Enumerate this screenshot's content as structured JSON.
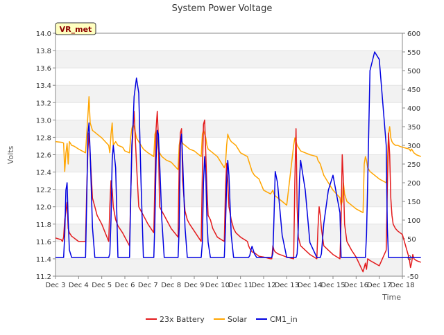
{
  "chart_data": {
    "type": "line",
    "title": "System Power Voltage",
    "xlabel": "Time",
    "ylabel": "Volts",
    "site_label": "VR_met",
    "x_ticks": [
      "Dec 3",
      "Dec 4",
      "Dec 5",
      "Dec 6",
      "Dec 7",
      "Dec 8",
      "Dec 9",
      "Dec 10",
      "Dec 11",
      "Dec 12",
      "Dec 13",
      "Dec 14",
      "Dec 15",
      "Dec 16",
      "Dec 17",
      "Dec 18"
    ],
    "x_range": [
      3,
      18
    ],
    "y_left": {
      "range": [
        11.2,
        14.0
      ],
      "ticks": [
        "11.2",
        "11.4",
        "11.6",
        "11.8",
        "12.0",
        "12.2",
        "12.4",
        "12.6",
        "12.8",
        "13.0",
        "13.2",
        "13.4",
        "13.6",
        "13.8",
        "14.0"
      ]
    },
    "y_right": {
      "range": [
        -50,
        600
      ],
      "ticks": [
        "-50",
        "0",
        "50",
        "100",
        "150",
        "200",
        "250",
        "300",
        "350",
        "400",
        "450",
        "500",
        "550",
        "600"
      ]
    },
    "grid": true,
    "legend_position": "bottom",
    "series": [
      {
        "name": "23x Battery",
        "axis": "left",
        "color": "#e31a1c",
        "x": [
          3.0,
          3.25,
          3.3,
          3.35,
          3.4,
          3.45,
          3.5,
          3.55,
          3.6,
          3.7,
          3.8,
          3.9,
          4.0,
          4.3,
          4.35,
          4.4,
          4.45,
          4.5,
          4.6,
          4.7,
          4.8,
          5.0,
          5.3,
          5.35,
          5.4,
          5.45,
          5.5,
          5.6,
          5.7,
          5.9,
          6.0,
          6.2,
          6.25,
          6.3,
          6.35,
          6.4,
          6.5,
          6.6,
          6.7,
          6.8,
          7.0,
          7.25,
          7.3,
          7.35,
          7.4,
          7.45,
          7.5,
          7.6,
          7.7,
          7.8,
          8.0,
          8.3,
          8.35,
          8.4,
          8.45,
          8.5,
          8.6,
          8.7,
          8.8,
          9.0,
          9.3,
          9.35,
          9.4,
          9.45,
          9.5,
          9.55,
          9.6,
          9.7,
          9.8,
          10.0,
          10.3,
          10.35,
          10.4,
          10.45,
          10.5,
          10.6,
          10.7,
          10.8,
          11.0,
          11.3,
          11.35,
          11.4,
          11.45,
          11.5,
          11.6,
          11.7,
          11.8,
          12.0,
          12.3,
          12.35,
          12.4,
          12.45,
          12.5,
          12.6,
          12.8,
          13.0,
          13.3,
          13.35,
          13.4,
          13.45,
          13.5,
          13.55,
          13.6,
          13.8,
          14.0,
          14.3,
          14.35,
          14.4,
          14.45,
          14.5,
          14.6,
          14.8,
          15.0,
          15.3,
          15.35,
          15.4,
          15.45,
          15.5,
          15.6,
          15.8,
          16.0,
          16.3,
          16.35,
          16.4,
          16.45,
          16.5,
          16.6,
          16.8,
          17.0,
          17.3,
          17.35,
          17.4,
          17.45,
          17.5,
          17.55,
          17.6,
          17.7,
          17.8,
          17.9,
          18.0,
          18.3,
          18.35,
          18.4,
          18.45,
          18.5,
          18.6,
          18.8
        ],
        "values": [
          11.64,
          11.62,
          11.6,
          11.65,
          11.85,
          11.95,
          12.05,
          11.75,
          11.7,
          11.66,
          11.64,
          11.62,
          11.6,
          11.6,
          12.2,
          12.65,
          12.85,
          12.6,
          12.1,
          12.0,
          11.9,
          11.8,
          11.6,
          12.0,
          12.3,
          12.2,
          12.0,
          11.85,
          11.78,
          11.7,
          11.65,
          11.55,
          12.1,
          12.6,
          12.9,
          13.1,
          12.5,
          12.0,
          11.95,
          11.9,
          11.8,
          11.7,
          12.3,
          12.9,
          13.1,
          12.8,
          12.0,
          11.95,
          11.9,
          11.85,
          11.75,
          11.65,
          12.5,
          12.85,
          12.9,
          12.3,
          11.95,
          11.85,
          11.8,
          11.72,
          11.6,
          12.4,
          12.95,
          13.0,
          12.6,
          12.2,
          11.9,
          11.85,
          11.75,
          11.65,
          11.6,
          12.2,
          12.5,
          12.3,
          12.0,
          11.85,
          11.75,
          11.7,
          11.65,
          11.6,
          11.55,
          11.52,
          11.5,
          11.48,
          11.47,
          11.45,
          11.43,
          11.42,
          11.4,
          11.4,
          11.55,
          11.5,
          11.48,
          11.46,
          11.44,
          11.42,
          11.4,
          12.3,
          12.9,
          12.0,
          11.65,
          11.6,
          11.55,
          11.5,
          11.45,
          11.4,
          11.75,
          12.0,
          11.9,
          11.75,
          11.55,
          11.5,
          11.45,
          11.4,
          11.85,
          12.6,
          12.3,
          11.8,
          11.6,
          11.5,
          11.42,
          11.25,
          11.3,
          11.35,
          11.28,
          11.4,
          11.38,
          11.35,
          11.32,
          11.5,
          12.2,
          12.85,
          12.6,
          12.1,
          11.9,
          11.8,
          11.75,
          11.72,
          11.7,
          11.68,
          11.4,
          11.3,
          11.35,
          11.45,
          11.4,
          11.38,
          11.36
        ]
      },
      {
        "name": "Solar",
        "axis": "right",
        "color": "#ffa500",
        "x": [
          3.0,
          3.3,
          3.35,
          3.4,
          3.45,
          3.5,
          3.55,
          3.6,
          3.7,
          3.8,
          4.0,
          4.3,
          4.35,
          4.4,
          4.45,
          4.5,
          4.6,
          4.7,
          4.8,
          5.0,
          5.3,
          5.35,
          5.4,
          5.45,
          5.5,
          5.6,
          5.7,
          5.9,
          6.0,
          6.2,
          6.25,
          6.3,
          6.35,
          6.4,
          6.5,
          6.6,
          6.7,
          6.8,
          7.0,
          7.25,
          7.3,
          7.35,
          7.4,
          7.45,
          7.5,
          7.6,
          7.7,
          7.8,
          8.0,
          8.3,
          8.35,
          8.4,
          8.45,
          8.5,
          8.6,
          8.7,
          8.8,
          9.0,
          9.3,
          9.35,
          9.4,
          9.45,
          9.5,
          9.55,
          9.6,
          9.7,
          9.8,
          10.0,
          10.3,
          10.35,
          10.4,
          10.45,
          10.5,
          10.6,
          10.7,
          10.8,
          11.0,
          11.3,
          11.35,
          11.4,
          11.45,
          11.5,
          11.6,
          11.7,
          11.8,
          12.0,
          12.3,
          12.35,
          12.4,
          12.45,
          12.5,
          12.6,
          12.8,
          13.0,
          13.3,
          13.35,
          13.4,
          13.45,
          13.5,
          13.55,
          13.6,
          13.8,
          14.0,
          14.3,
          14.35,
          14.4,
          14.45,
          14.5,
          14.6,
          14.8,
          15.0,
          15.3,
          15.35,
          15.4,
          15.45,
          15.5,
          15.6,
          15.8,
          16.0,
          16.3,
          16.35,
          16.4,
          16.45,
          16.5,
          16.6,
          16.8,
          17.0,
          17.3,
          17.35,
          17.4,
          17.45,
          17.5,
          17.55,
          17.6,
          17.7,
          17.8,
          17.9,
          18.0,
          18.3,
          18.35,
          18.4,
          18.45,
          18.5,
          18.6,
          18.8
        ],
        "values": [
          310,
          308,
          306,
          230,
          280,
          305,
          250,
          310,
          300,
          298,
          290,
          280,
          330,
          380,
          430,
          360,
          340,
          335,
          330,
          320,
          300,
          280,
          330,
          360,
          300,
          310,
          300,
          295,
          285,
          280,
          320,
          345,
          355,
          350,
          320,
          310,
          300,
          290,
          280,
          270,
          330,
          340,
          320,
          290,
          280,
          270,
          265,
          260,
          255,
          235,
          300,
          320,
          315,
          305,
          300,
          295,
          290,
          285,
          270,
          330,
          340,
          330,
          320,
          300,
          290,
          285,
          280,
          270,
          240,
          250,
          300,
          330,
          320,
          310,
          305,
          300,
          280,
          270,
          260,
          250,
          240,
          230,
          220,
          215,
          210,
          180,
          170,
          175,
          180,
          170,
          165,
          160,
          150,
          140,
          300,
          320,
          310,
          300,
          295,
          290,
          285,
          280,
          275,
          270,
          260,
          255,
          250,
          240,
          220,
          200,
          180,
          160,
          140,
          150,
          200,
          170,
          150,
          140,
          130,
          120,
          250,
          270,
          260,
          240,
          230,
          220,
          210,
          200,
          250,
          330,
          350,
          320,
          310,
          305,
          300,
          300,
          297,
          295,
          290,
          285,
          290,
          285,
          280,
          275,
          270
        ]
      },
      {
        "name": "CM1_in",
        "axis": "right",
        "color": "#0000e0",
        "x": [
          3.0,
          3.3,
          3.35,
          3.4,
          3.45,
          3.5,
          3.55,
          3.6,
          3.7,
          3.8,
          4.0,
          4.3,
          4.35,
          4.4,
          4.45,
          4.5,
          4.6,
          4.7,
          4.8,
          5.0,
          5.3,
          5.35,
          5.4,
          5.45,
          5.5,
          5.6,
          5.7,
          5.9,
          6.0,
          6.2,
          6.25,
          6.3,
          6.35,
          6.4,
          6.5,
          6.6,
          6.7,
          6.8,
          7.0,
          7.25,
          7.3,
          7.35,
          7.4,
          7.45,
          7.5,
          7.6,
          7.7,
          7.8,
          8.0,
          8.3,
          8.35,
          8.4,
          8.45,
          8.5,
          8.6,
          8.7,
          8.8,
          9.0,
          9.3,
          9.35,
          9.4,
          9.45,
          9.5,
          9.55,
          9.6,
          9.7,
          9.8,
          10.0,
          10.3,
          10.35,
          10.4,
          10.45,
          10.5,
          10.6,
          10.7,
          10.8,
          11.0,
          11.3,
          11.35,
          11.4,
          11.45,
          11.5,
          11.6,
          11.7,
          11.8,
          12.0,
          12.3,
          12.35,
          12.4,
          12.45,
          12.5,
          12.6,
          12.8,
          13.0,
          13.3,
          13.35,
          13.4,
          13.45,
          13.5,
          13.55,
          13.6,
          13.8,
          14.0,
          14.3,
          14.35,
          14.4,
          14.45,
          14.5,
          14.6,
          14.8,
          15.0,
          15.3,
          15.35,
          15.4,
          15.45,
          15.5,
          15.6,
          15.8,
          16.0,
          16.3,
          16.35,
          16.4,
          16.45,
          16.5,
          16.6,
          16.8,
          17.0,
          17.3,
          17.35,
          17.4,
          17.45,
          17.5,
          17.55,
          17.6,
          17.7,
          17.8,
          17.9,
          18.0,
          18.3,
          18.35,
          18.4,
          18.45,
          18.5,
          18.6,
          18.8
        ],
        "values": [
          0,
          0,
          0,
          60,
          180,
          200,
          100,
          20,
          0,
          0,
          0,
          0,
          150,
          330,
          360,
          280,
          80,
          0,
          0,
          0,
          0,
          10,
          100,
          260,
          300,
          240,
          0,
          0,
          0,
          0,
          150,
          300,
          350,
          430,
          480,
          440,
          200,
          0,
          0,
          0,
          100,
          260,
          340,
          330,
          260,
          100,
          0,
          0,
          0,
          0,
          80,
          300,
          330,
          260,
          80,
          0,
          0,
          0,
          0,
          40,
          200,
          270,
          220,
          100,
          40,
          0,
          0,
          0,
          0,
          80,
          200,
          260,
          220,
          60,
          0,
          0,
          0,
          0,
          0,
          5,
          20,
          30,
          10,
          0,
          0,
          0,
          0,
          0,
          10,
          110,
          230,
          200,
          60,
          0,
          0,
          0,
          0,
          10,
          80,
          210,
          260,
          180,
          40,
          0,
          0,
          0,
          0,
          10,
          90,
          180,
          220,
          120,
          0,
          0,
          0,
          0,
          0,
          0,
          0,
          0,
          0,
          0,
          60,
          200,
          500,
          550,
          530,
          300,
          80,
          0,
          0,
          0,
          0,
          0,
          0,
          0,
          0,
          0,
          0,
          0,
          0,
          0,
          0,
          0,
          0
        ]
      }
    ]
  }
}
